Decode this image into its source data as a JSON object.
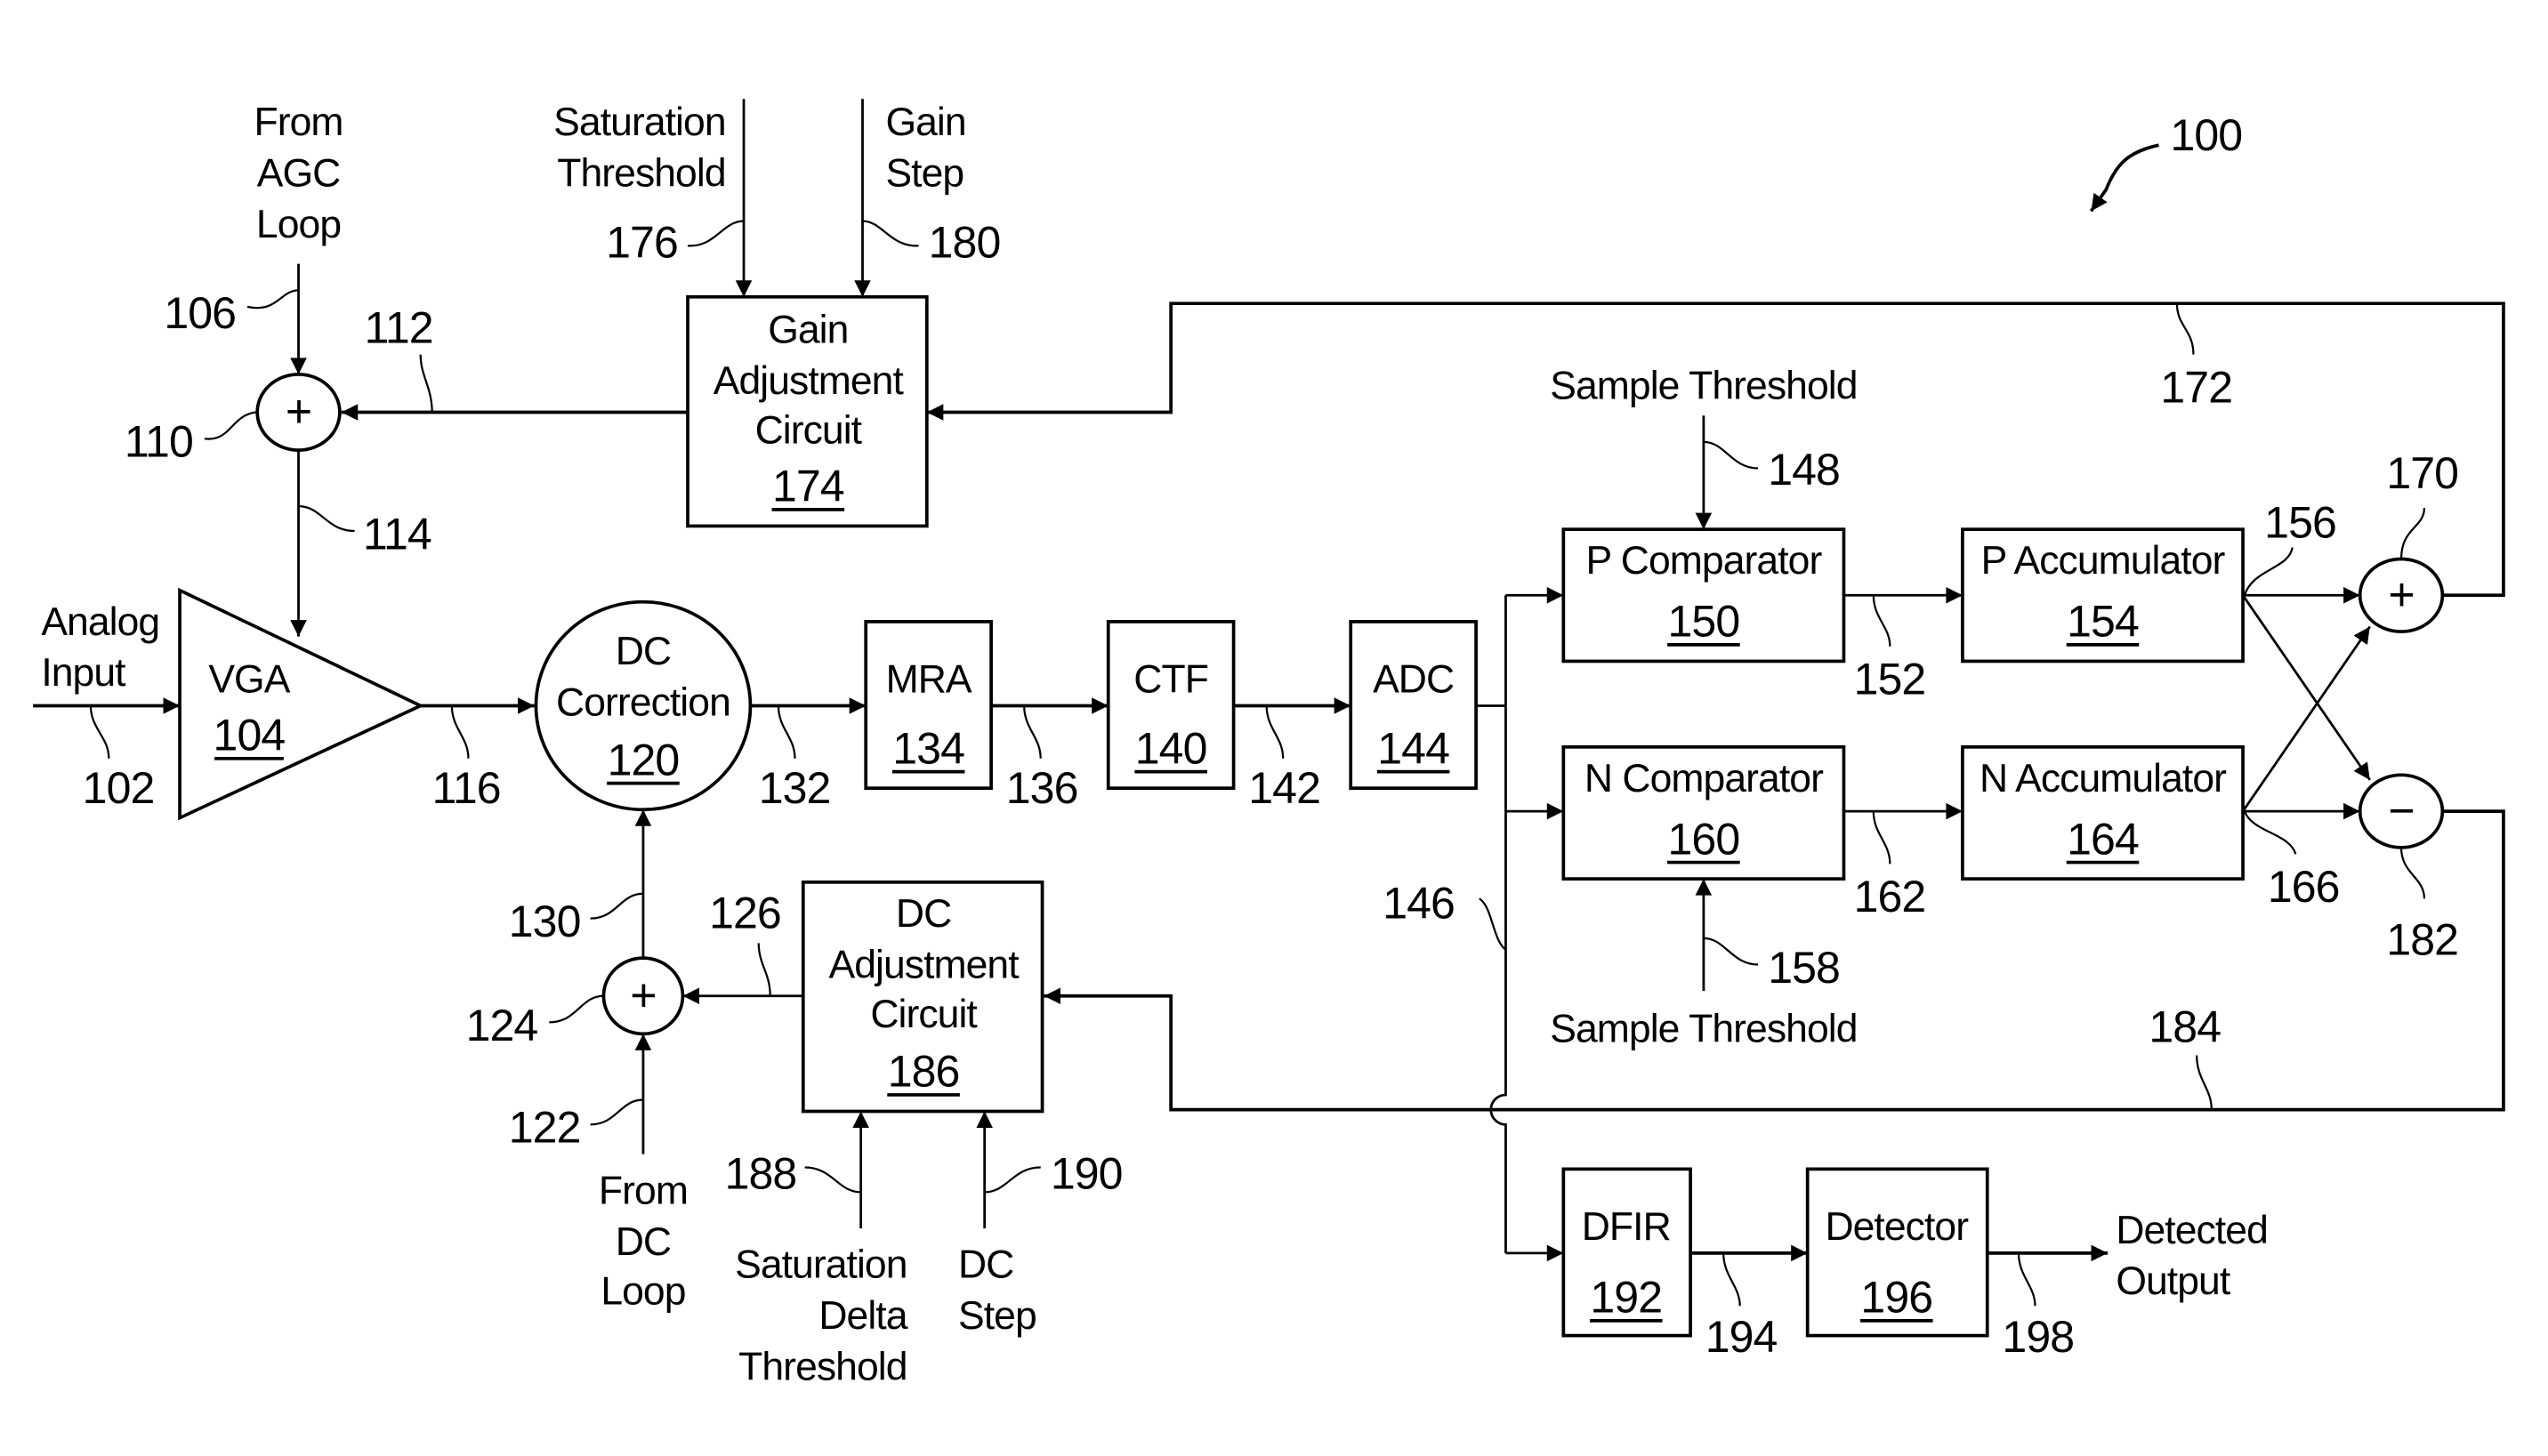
{
  "figure": {
    "reference": "100",
    "colors": {
      "ink": "#000000",
      "background": "#ffffff"
    }
  },
  "inputs": {
    "from_agc_loop": [
      "From",
      "AGC",
      "Loop"
    ],
    "saturation_threshold": [
      "Saturation",
      "Threshold"
    ],
    "gain_step": [
      "Gain",
      "Step"
    ],
    "analog_input": [
      "Analog",
      "Input"
    ],
    "sample_threshold_p": "Sample Threshold",
    "sample_threshold_n": "Sample Threshold",
    "from_dc_loop": [
      "From",
      "DC",
      "Loop"
    ],
    "saturation_delta_threshold": [
      "Saturation",
      "Delta",
      "Threshold"
    ],
    "dc_step": [
      "DC",
      "Step"
    ],
    "detected_output": [
      "Detected",
      "Output"
    ]
  },
  "blocks": {
    "vga": {
      "label": "VGA",
      "ref": "104"
    },
    "dc_correction": {
      "label": [
        "DC",
        "Correction"
      ],
      "ref": "120"
    },
    "mra": {
      "label": "MRA",
      "ref": "134"
    },
    "ctf": {
      "label": "CTF",
      "ref": "140"
    },
    "adc": {
      "label": "ADC",
      "ref": "144"
    },
    "gain_adjustment": {
      "label": [
        "Gain",
        "Adjustment",
        "Circuit"
      ],
      "ref": "174"
    },
    "p_comparator": {
      "label": "P Comparator",
      "ref": "150"
    },
    "p_accumulator": {
      "label": "P Accumulator",
      "ref": "154"
    },
    "n_comparator": {
      "label": "N Comparator",
      "ref": "160"
    },
    "n_accumulator": {
      "label": "N Accumulator",
      "ref": "164"
    },
    "dc_adjustment": {
      "label": [
        "DC",
        "Adjustment",
        "Circuit"
      ],
      "ref": "186"
    },
    "dfir": {
      "label": "DFIR",
      "ref": "192"
    },
    "detector": {
      "label": "Detector",
      "ref": "196"
    }
  },
  "summers": {
    "agc_sum": {
      "symbol": "+",
      "ref": "110"
    },
    "dc_sum": {
      "symbol": "+",
      "ref": "124"
    },
    "p_sum": {
      "symbol": "+",
      "ref": "170"
    },
    "n_diff": {
      "symbol": "−",
      "ref": "182"
    }
  },
  "signal_refs": {
    "s102": "102",
    "s106": "106",
    "s112": "112",
    "s114": "114",
    "s116": "116",
    "s122": "122",
    "s126": "126",
    "s130": "130",
    "s132": "132",
    "s136": "136",
    "s142": "142",
    "s146": "146",
    "s148": "148",
    "s152": "152",
    "s156": "156",
    "s158": "158",
    "s162": "162",
    "s166": "166",
    "s172": "172",
    "s176": "176",
    "s180": "180",
    "s184": "184",
    "s188": "188",
    "s190": "190",
    "s194": "194",
    "s198": "198"
  }
}
